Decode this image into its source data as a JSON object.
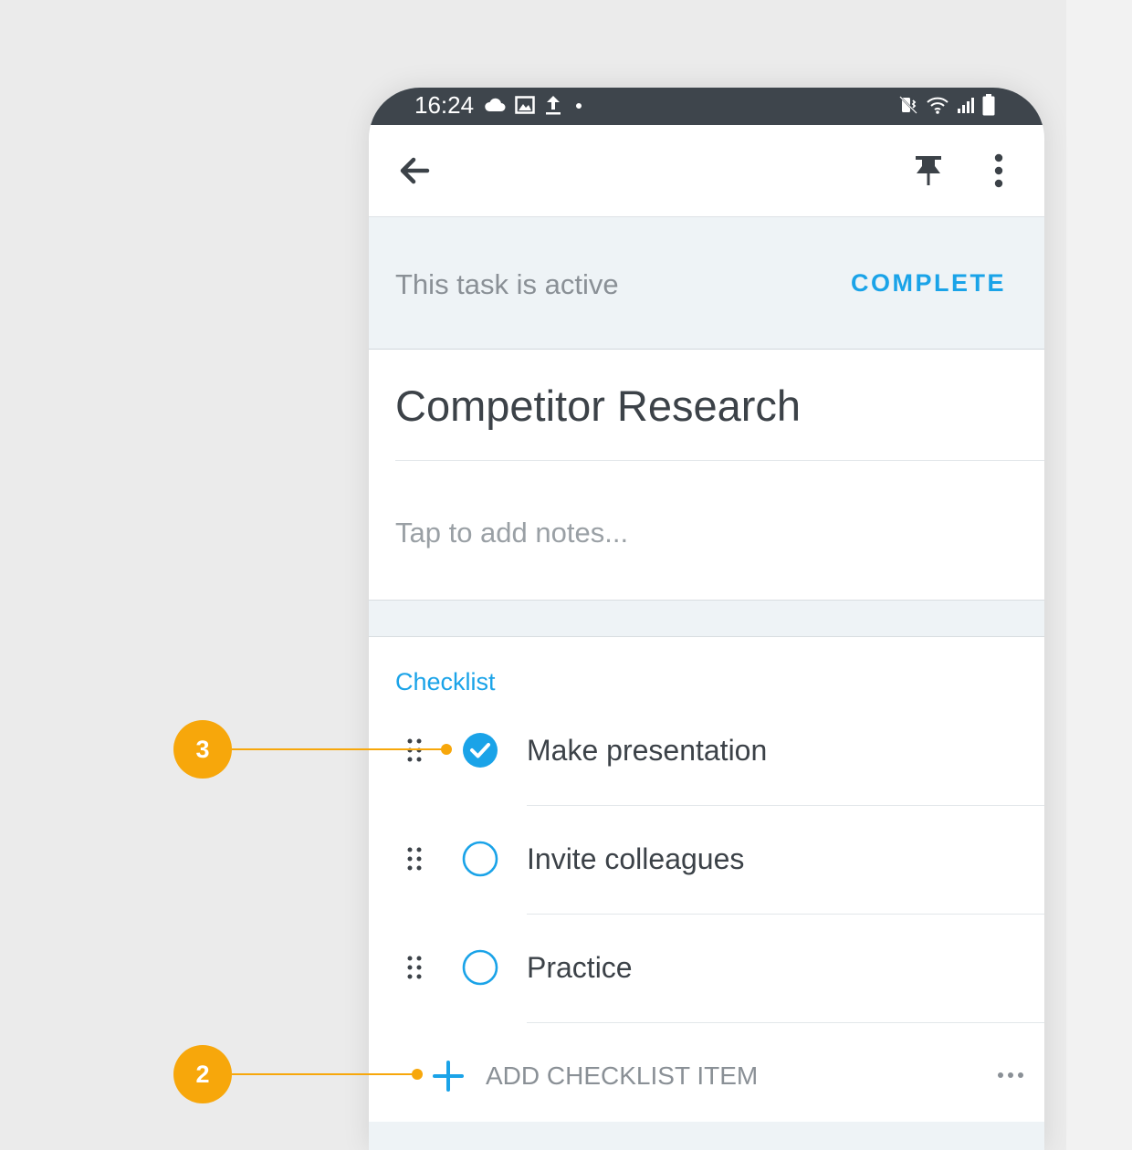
{
  "statusbar": {
    "time": "16:24",
    "left_icons": [
      "cloud-icon",
      "image-icon",
      "upload-icon",
      "dot-icon"
    ],
    "right_icons": [
      "mute-vibrate-icon",
      "wifi-icon",
      "signal-icon",
      "battery-icon"
    ]
  },
  "appbar": {
    "icons": [
      "back-arrow-icon",
      "pin-icon",
      "more-vertical-icon"
    ]
  },
  "status_banner": {
    "text": "This task is active",
    "action_label": "COMPLETE"
  },
  "task": {
    "title": "Competitor Research",
    "notes_placeholder": "Tap to add notes..."
  },
  "checklist": {
    "section_title": "Checklist",
    "items": [
      {
        "label": "Make presentation",
        "checked": true
      },
      {
        "label": "Invite colleagues",
        "checked": false
      },
      {
        "label": "Practice",
        "checked": false
      }
    ],
    "add_label": "ADD CHECKLIST ITEM"
  },
  "callouts": [
    {
      "number": "3",
      "target": "checklist-item-checkbox"
    },
    {
      "number": "2",
      "target": "add-checklist-item-button"
    }
  ],
  "colors": {
    "accent": "#1aa3e8",
    "callout": "#f7a70b",
    "statusbar": "#3e454c",
    "text_primary": "#3c4248",
    "text_secondary": "#8a9096"
  }
}
